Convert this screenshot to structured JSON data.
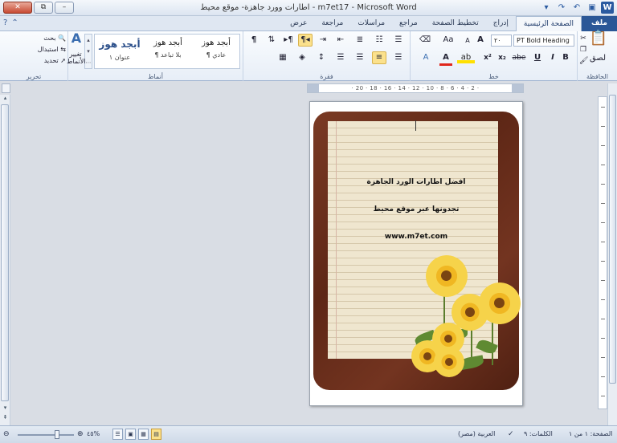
{
  "window": {
    "title": "اطارات وورد جاهزة- موقع محيط - m7et17 - Microsoft Word",
    "app_icon": "W",
    "controls": [
      "✕",
      "⧉",
      "–"
    ]
  },
  "tabs": [
    {
      "label": "ملف",
      "kind": "file"
    },
    {
      "label": "الصفحة الرئيسية",
      "kind": "active"
    },
    {
      "label": "إدراج"
    },
    {
      "label": "تخطيط الصفحة"
    },
    {
      "label": "مراجع"
    },
    {
      "label": "مراسلات"
    },
    {
      "label": "مراجعة"
    },
    {
      "label": "عرض"
    }
  ],
  "ribbon": {
    "clipboard": {
      "label": "الحافظة",
      "paste_label": "لصق"
    },
    "font": {
      "label": "خط",
      "font_name": "PT Bold Heading",
      "font_size": "٢٠",
      "bold": "B",
      "italic": "I",
      "underline": "U",
      "strike": "abe",
      "subscript": "x₂",
      "superscript": "x²",
      "grow": "A",
      "shrink": "A",
      "case": "Aa",
      "highlight": "ab",
      "color": "A"
    },
    "paragraph": {
      "label": "فقرة",
      "show_marks": "¶"
    },
    "styles": {
      "label": "أنماط",
      "items": [
        {
          "sample": "أبجد هوز",
          "name": "¶ عادي"
        },
        {
          "sample": "أبجد هوز",
          "name": "¶ بلا تباعد"
        },
        {
          "sample": "أبجد هوز",
          "name": "عنوان ١"
        }
      ],
      "change_label": "تغيير الأنماط"
    },
    "editing": {
      "label": "تحرير",
      "find": "بحث",
      "replace": "استبدال",
      "select": "تحديد"
    }
  },
  "ruler": {
    "marks": "· 20 · 18 · 16 · 14 · 12 · 10 · 8 · 6 · 4 · 2 ·"
  },
  "document": {
    "line1": "افضل اطارات الورد الجاهزة",
    "line2": "تجدونها عبر موقع محيط",
    "line3": "www.m7et.com"
  },
  "status": {
    "page": "الصفحة: ١ من ١",
    "words": "الكلمات: ٩",
    "language": "العربية (مصر)",
    "zoom": "٤٥%"
  },
  "colors": {
    "accent": "#2b5797",
    "frame": "#6b2f1b",
    "paper": "#efe6cf",
    "flower": "#f6d34a"
  }
}
